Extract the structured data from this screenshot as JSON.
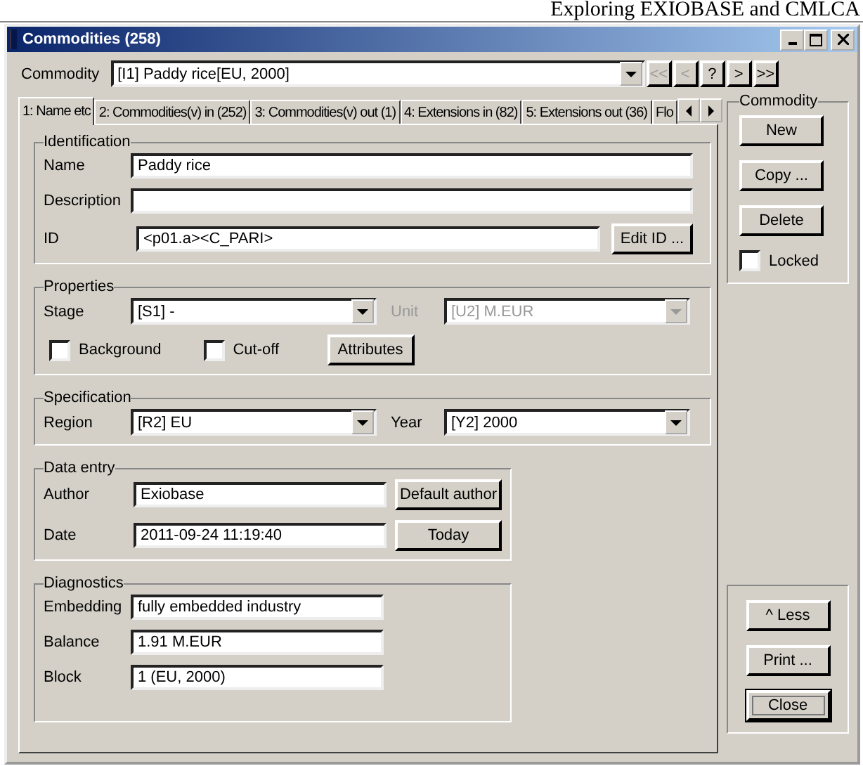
{
  "page_header": "Exploring EXIOBASE and CMLCA",
  "window": {
    "title": "Commodities (258)"
  },
  "commodity_select": {
    "label": "Commodity",
    "value": "[I1] Paddy rice[EU, 2000]"
  },
  "nav_buttons": [
    {
      "label": "<<",
      "disabled": true
    },
    {
      "label": "<",
      "disabled": true
    },
    {
      "label": "?",
      "disabled": false
    },
    {
      "label": ">",
      "disabled": false
    },
    {
      "label": ">>",
      "disabled": false
    }
  ],
  "tabs": [
    {
      "label": "1: Name etc",
      "selected": true
    },
    {
      "label": "2: Commodities(v) in (252)",
      "selected": false
    },
    {
      "label": "3: Commodities(v) out (1)",
      "selected": false
    },
    {
      "label": "4: Extensions in (82)",
      "selected": false
    },
    {
      "label": "5: Extensions out (36)",
      "selected": false
    },
    {
      "label": "Flo",
      "selected": false
    }
  ],
  "identification": {
    "title": "Identification",
    "name_label": "Name",
    "name": "Paddy rice",
    "description_label": "Description",
    "id_label": "ID",
    "id": "<p01.a><C_PARI>",
    "edit_button": "Edit ID ..."
  },
  "properties": {
    "title": "Properties",
    "stage_label": "Stage",
    "stage": "[S1] -",
    "unit_label": "Unit",
    "unit": "[U2] M.EUR",
    "unit_disabled": true,
    "checkboxes": [
      {
        "label": "Background",
        "checked": false
      },
      {
        "label": "Cut-off",
        "checked": false
      }
    ],
    "attributes_button": "Attributes"
  },
  "specification": {
    "title": "Specification",
    "region_label": "Region",
    "region": "[R2] EU",
    "year_label": "Year",
    "year": "[Y2] 2000"
  },
  "data_entry": {
    "title": "Data entry",
    "author_label": "Author",
    "author": "Exiobase",
    "author_button": "Default author",
    "date_label": "Date",
    "date": "2011-09-24 11:19:40",
    "date_button": "Today"
  },
  "diagnostics": {
    "title": "Diagnostics",
    "fields": [
      {
        "label": "Embedding",
        "value": "fully embedded industry"
      },
      {
        "label": "Balance",
        "value": "1.91 M.EUR"
      },
      {
        "label": "Block",
        "value": "1 (EU, 2000)"
      }
    ]
  },
  "side_group": {
    "title": "Commodity",
    "buttons": [
      "New",
      "Copy ...",
      "Delete"
    ],
    "locked": {
      "label": "Locked",
      "checked": false
    }
  },
  "bottom_buttons": [
    {
      "label": "^ Less",
      "default": false
    },
    {
      "label": "Print ...",
      "default": false
    },
    {
      "label": "Close",
      "default": true
    }
  ]
}
